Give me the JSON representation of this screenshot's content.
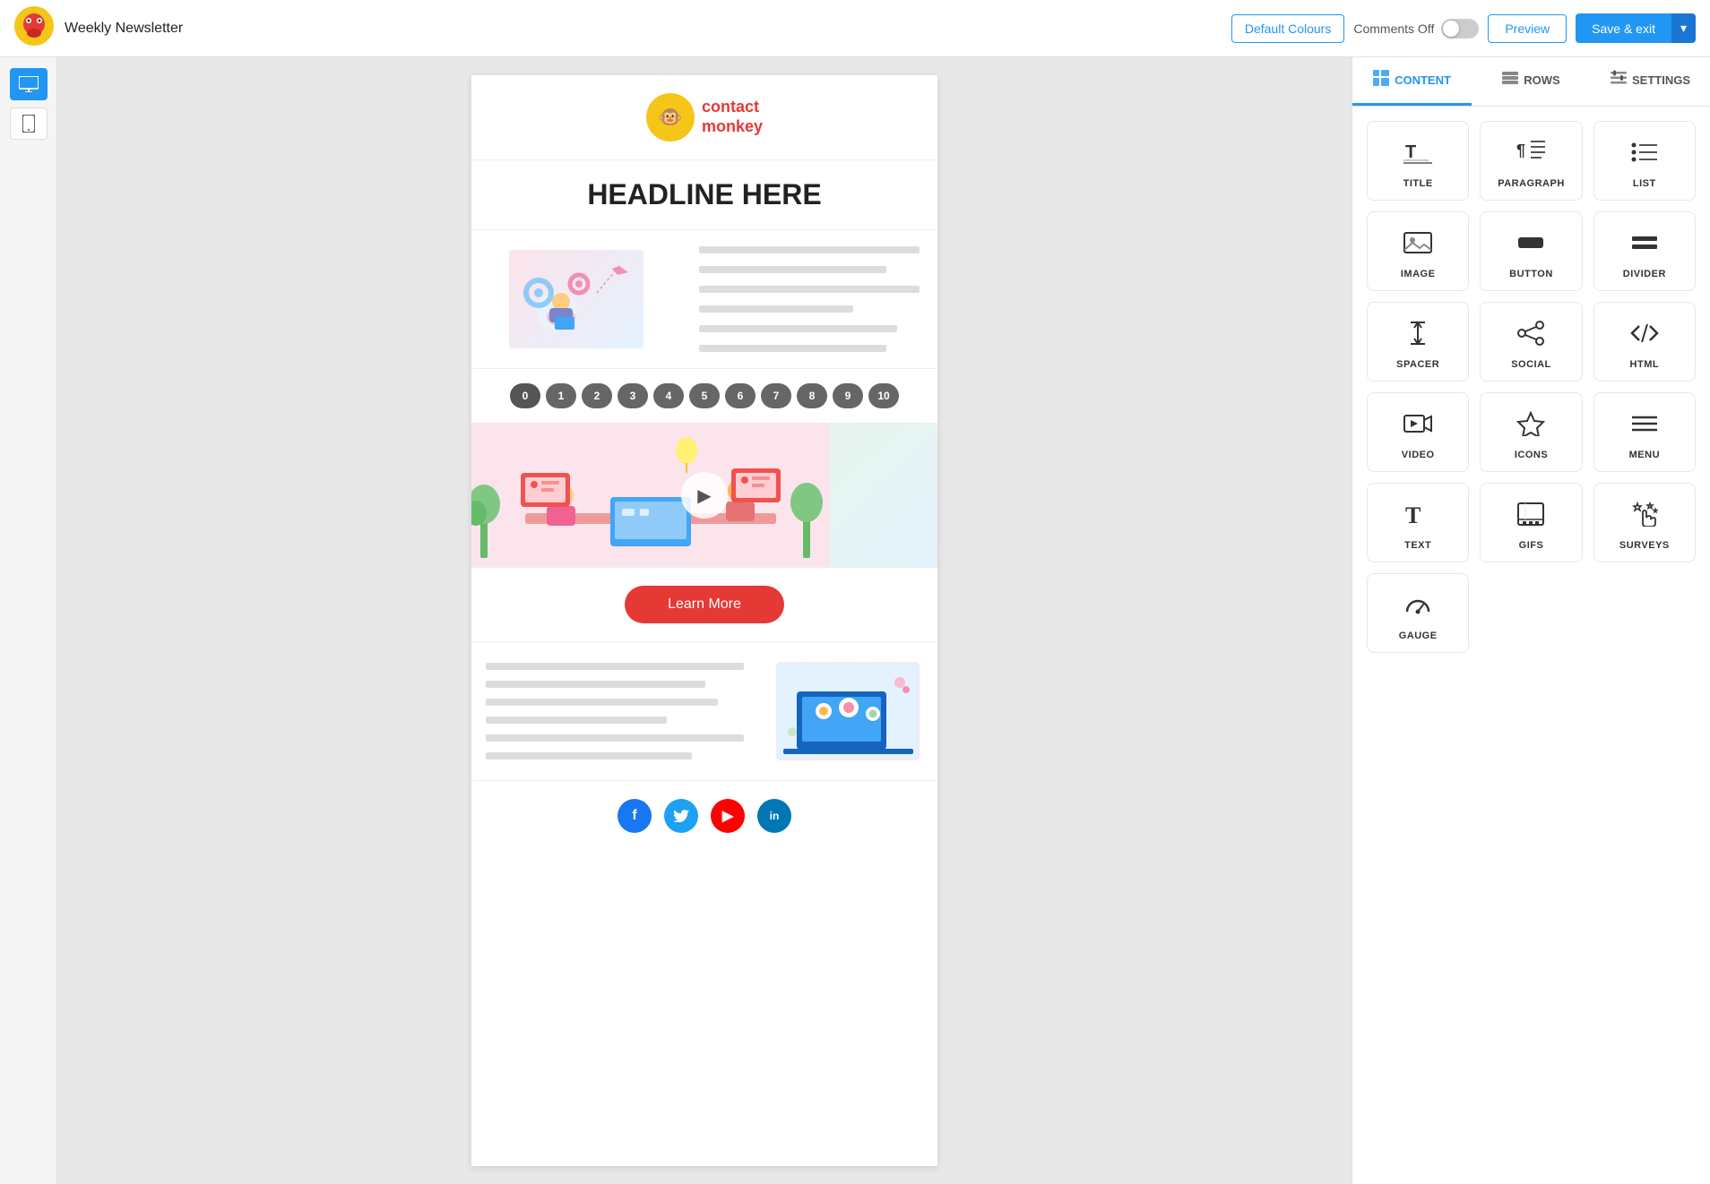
{
  "topbar": {
    "title": "Weekly Newsletter",
    "default_colours_label": "Default Colours",
    "comments_off_label": "Comments Off",
    "preview_label": "Preview",
    "save_exit_label": "Save & exit"
  },
  "view_toggles": {
    "desktop_label": "desktop",
    "mobile_label": "mobile"
  },
  "email": {
    "logo_text_line1": "contact",
    "logo_text_line2": "monkey",
    "headline": "HEADLINE HERE",
    "rating_items": [
      "0",
      "1",
      "2",
      "3",
      "4",
      "5",
      "6",
      "7",
      "8",
      "9",
      "10"
    ],
    "cta_label": "Learn More",
    "social_icons": [
      "f",
      "t",
      "▶",
      "in"
    ]
  },
  "panel": {
    "tabs": [
      {
        "id": "content",
        "label": "CONTENT",
        "active": true
      },
      {
        "id": "rows",
        "label": "ROWS",
        "active": false
      },
      {
        "id": "settings",
        "label": "SETTINGS",
        "active": false
      }
    ],
    "content_items": [
      {
        "id": "title",
        "label": "TITLE"
      },
      {
        "id": "paragraph",
        "label": "PARAGRAPH"
      },
      {
        "id": "list",
        "label": "LIST"
      },
      {
        "id": "image",
        "label": "IMAGE"
      },
      {
        "id": "button",
        "label": "BUTTON"
      },
      {
        "id": "divider",
        "label": "DIVIDER"
      },
      {
        "id": "spacer",
        "label": "SPACER"
      },
      {
        "id": "social",
        "label": "SOCIAL"
      },
      {
        "id": "html",
        "label": "HTML"
      },
      {
        "id": "video",
        "label": "VIDEO"
      },
      {
        "id": "icons",
        "label": "ICONS"
      },
      {
        "id": "menu",
        "label": "MENU"
      },
      {
        "id": "text",
        "label": "TEXT"
      },
      {
        "id": "gifs",
        "label": "GIFS"
      },
      {
        "id": "surveys",
        "label": "SURVEYS"
      },
      {
        "id": "gauge",
        "label": "GAUGE"
      }
    ]
  }
}
